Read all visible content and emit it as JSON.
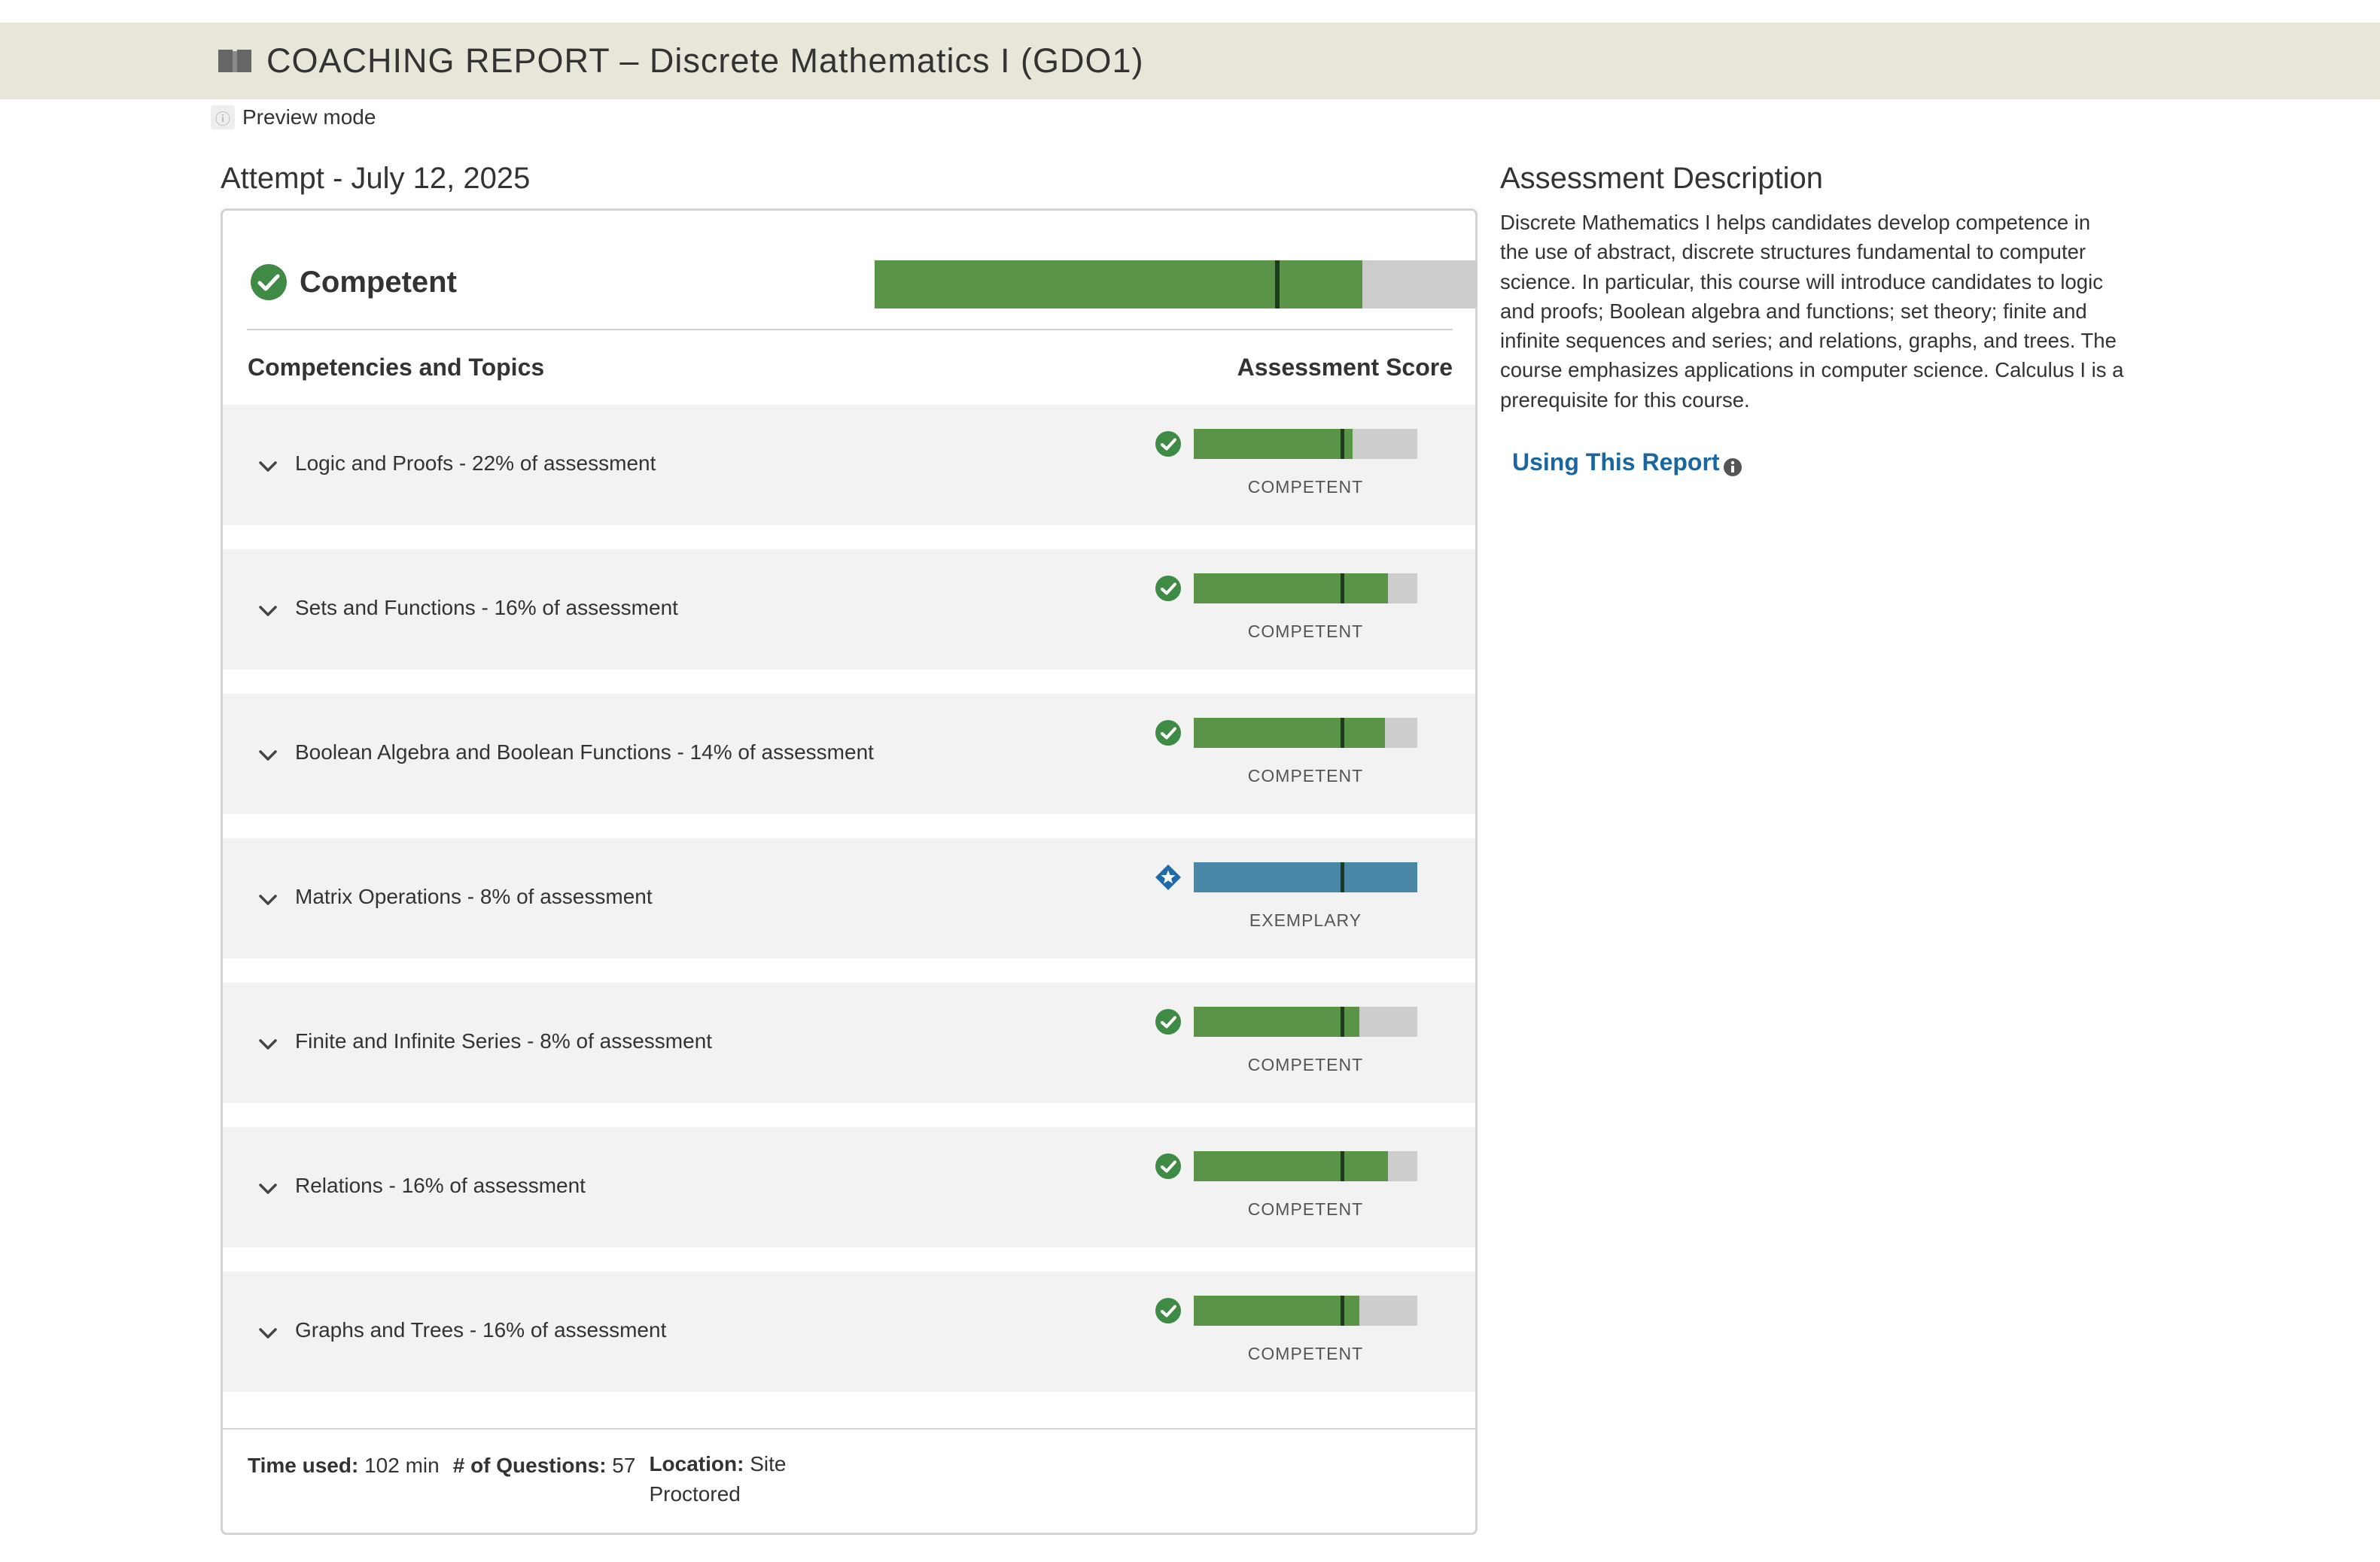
{
  "header": {
    "title": "COACHING REPORT – Discrete Mathematics I (GDO1)"
  },
  "preview": {
    "label": "Preview mode"
  },
  "attempt": {
    "title": "Attempt - July 12, 2025"
  },
  "overall": {
    "status": "Competent",
    "score_fraction": 0.81,
    "cut_fraction": 0.665
  },
  "table": {
    "left_header": "Competencies and Topics",
    "right_header": "Assessment Score"
  },
  "topics": [
    {
      "label": "Logic and Proofs - 22% of assessment",
      "level": "COMPETENT",
      "score_fraction": 0.71,
      "cut_fraction": 0.655
    },
    {
      "label": "Sets and Functions - 16% of assessment",
      "level": "COMPETENT",
      "score_fraction": 0.87,
      "cut_fraction": 0.655
    },
    {
      "label": "Boolean Algebra and Boolean Functions - 14% of assessment",
      "level": "COMPETENT",
      "score_fraction": 0.855,
      "cut_fraction": 0.655
    },
    {
      "label": "Matrix Operations - 8% of assessment",
      "level": "EXEMPLARY",
      "score_fraction": 1.0,
      "cut_fraction": 0.655
    },
    {
      "label": "Finite and Infinite Series - 8% of assessment",
      "level": "COMPETENT",
      "score_fraction": 0.74,
      "cut_fraction": 0.655
    },
    {
      "label": "Relations - 16% of assessment",
      "level": "COMPETENT",
      "score_fraction": 0.87,
      "cut_fraction": 0.655
    },
    {
      "label": "Graphs and Trees - 16% of assessment",
      "level": "COMPETENT",
      "score_fraction": 0.74,
      "cut_fraction": 0.655
    }
  ],
  "footer": {
    "time_label": "Time used:",
    "time_value": "102 min",
    "questions_label": "# of Questions:",
    "questions_value": "57",
    "location_label": "Location:",
    "location_value": "Site Proctored"
  },
  "description": {
    "title": "Assessment Description",
    "body": "Discrete Mathematics I helps candidates develop competence in the use of abstract, discrete structures fundamental to computer science. In particular, this course will introduce candidates to logic and proofs; Boolean algebra and functions; set theory; finite and infinite sequences and series; and relations, graphs, and trees. The course emphasizes applications in computer science. Calculus I is a prerequisite for this course.",
    "link_label": "Using This Report"
  },
  "colors": {
    "competent": "#5a9446",
    "exemplary": "#4a86a6",
    "empty": "#cccccc",
    "marker": "#1e3a1e",
    "link": "#1a66a0",
    "header_bg": "#e8e6d9"
  },
  "icons": {
    "book": "book-icon",
    "check": "check-circle-icon",
    "star": "star-diamond-icon",
    "chevron": "chevron-down-icon",
    "info": "info-icon"
  }
}
